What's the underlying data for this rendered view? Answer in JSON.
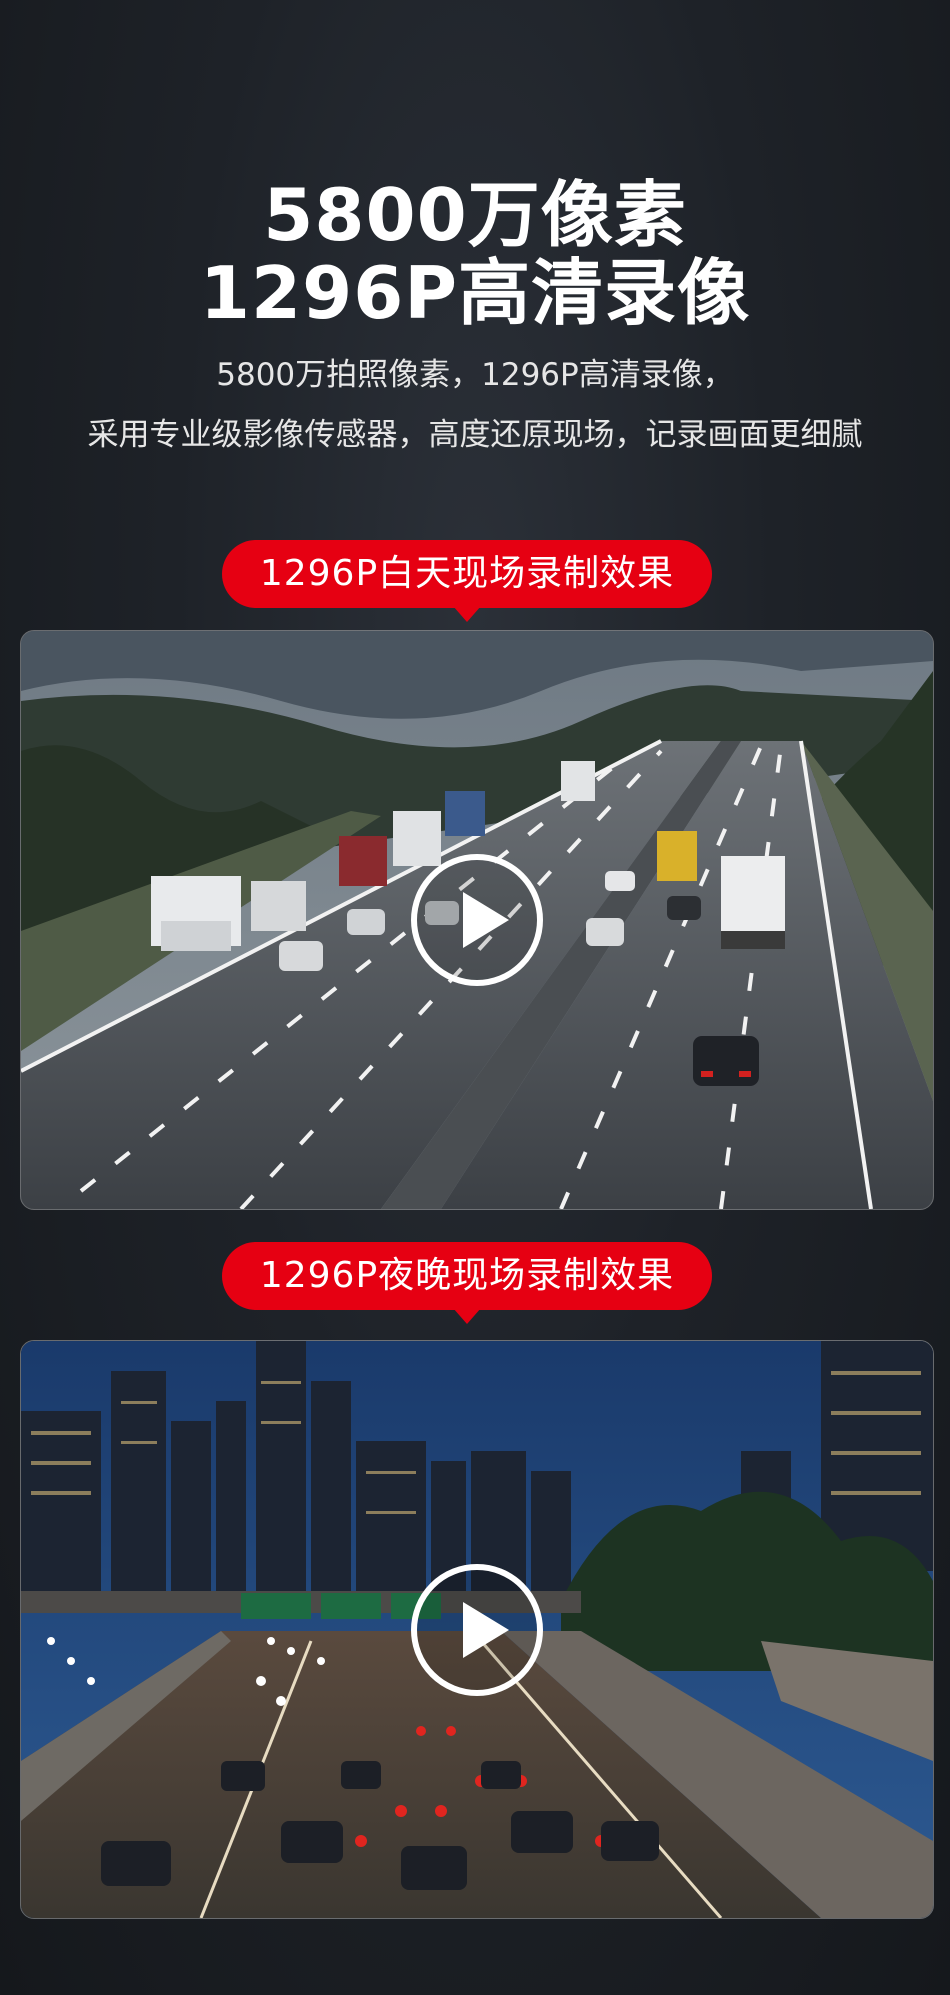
{
  "hero": {
    "title_line1": "5800万像素",
    "title_line2": "1296P高清录像",
    "desc_line1": "5800万拍照像素，1296P高清录像，",
    "desc_line2": "采用专业级影像传感器，高度还原现场，记录画面更细腻"
  },
  "sections": {
    "day": {
      "label": "1296P白天现场录制效果",
      "video_icon": "play-icon"
    },
    "night": {
      "label": "1296P夜晚现场录制效果",
      "video_icon": "play-icon"
    }
  },
  "colors": {
    "accent_red": "#e60012",
    "background": "#1e2228",
    "text": "#ffffff"
  }
}
